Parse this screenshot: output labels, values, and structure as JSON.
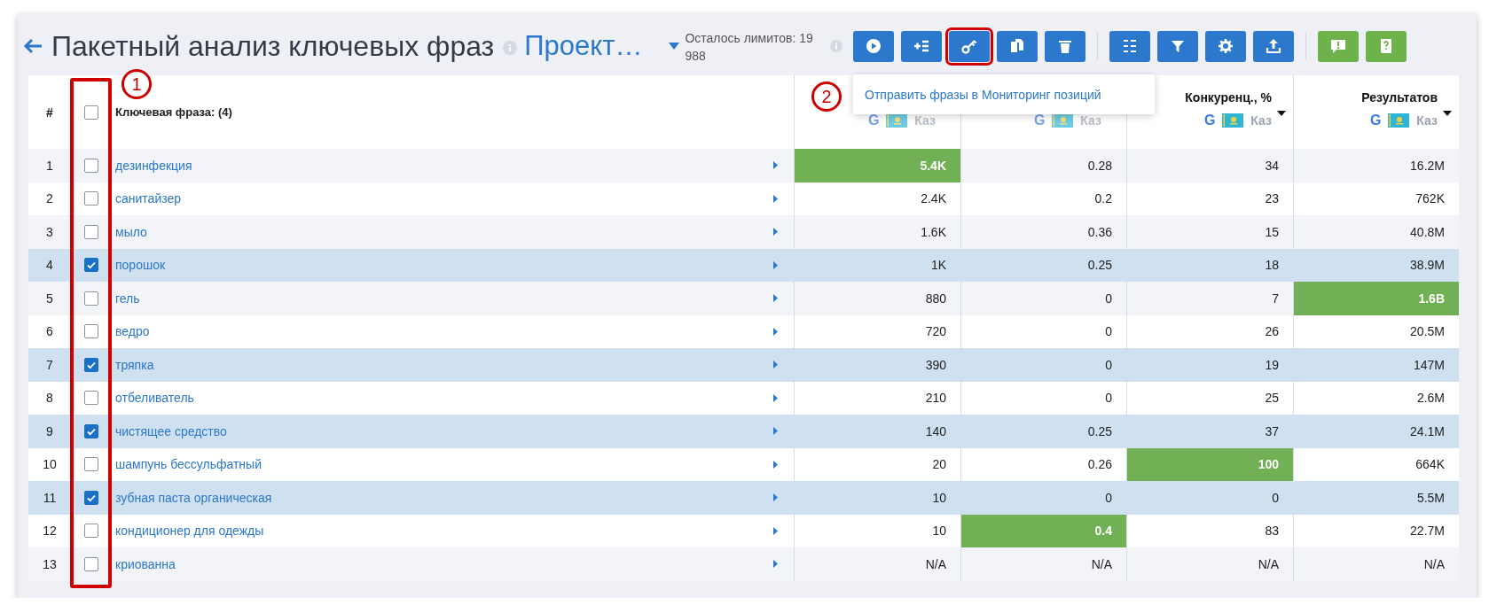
{
  "header": {
    "title": "Пакетный анализ ключевых фраз",
    "project": "Проект…",
    "limits": "Осталось лимитов: 19 988"
  },
  "toolbar": [
    {
      "kind": "play",
      "color": "#2b78cc",
      "outlined": false
    },
    {
      "kind": "add-list",
      "color": "#2b78cc",
      "outlined": false
    },
    {
      "kind": "key",
      "color": "#2b78cc",
      "outlined": true
    },
    {
      "kind": "copy",
      "color": "#2b78cc",
      "outlined": false
    },
    {
      "kind": "trash",
      "color": "#2b78cc",
      "outlined": false
    },
    {
      "kind": "columns",
      "color": "#2b78cc",
      "outlined": false
    },
    {
      "kind": "filter",
      "color": "#2b78cc",
      "outlined": false
    },
    {
      "kind": "gear",
      "color": "#2b78cc",
      "outlined": false
    },
    {
      "kind": "upload",
      "color": "#2b78cc",
      "outlined": false
    },
    {
      "kind": "alert",
      "color": "#6db24b",
      "outlined": false
    },
    {
      "kind": "help-book",
      "color": "#6db24b",
      "outlined": false
    }
  ],
  "popup": {
    "text": "Отправить фразы в Мониторинг позиций"
  },
  "markers": [
    "1",
    "2"
  ],
  "table": {
    "number_header": "#",
    "all_checked": false,
    "phrase_header": "Ключевая фраза: **(4)**",
    "columns": [
      {
        "engine": "G",
        "region": "Каз"
      },
      {
        "engine": "G",
        "region": "Каз"
      },
      {
        "title": "Конкуренц., %",
        "engine": "G",
        "region": "Каз",
        "sortable": true
      },
      {
        "title": "Результатов",
        "engine": "G",
        "region": "Каз",
        "sortable": true
      }
    ],
    "rows": [
      {
        "n": "1",
        "phrase": "дезинфекция",
        "checked": false,
        "cells": [
          {
            "v": "5.4K",
            "hl": true
          },
          {
            "v": "0.28",
            "hl": false
          },
          {
            "v": "34",
            "hl": false
          },
          {
            "v": "16.2M",
            "hl": false
          }
        ]
      },
      {
        "n": "2",
        "phrase": "санитайзер",
        "checked": false,
        "cells": [
          {
            "v": "2.4K",
            "hl": false
          },
          {
            "v": "0.2",
            "hl": false
          },
          {
            "v": "23",
            "hl": false
          },
          {
            "v": "762K",
            "hl": false
          }
        ]
      },
      {
        "n": "3",
        "phrase": "мыло",
        "checked": false,
        "cells": [
          {
            "v": "1.6K",
            "hl": false
          },
          {
            "v": "0.36",
            "hl": false
          },
          {
            "v": "15",
            "hl": false
          },
          {
            "v": "40.8M",
            "hl": false
          }
        ]
      },
      {
        "n": "4",
        "phrase": "порошок",
        "checked": true,
        "cells": [
          {
            "v": "1K",
            "hl": false
          },
          {
            "v": "0.25",
            "hl": false
          },
          {
            "v": "18",
            "hl": false
          },
          {
            "v": "38.9M",
            "hl": false
          }
        ]
      },
      {
        "n": "5",
        "phrase": "гель",
        "checked": false,
        "cells": [
          {
            "v": "880",
            "hl": false
          },
          {
            "v": "0",
            "hl": false
          },
          {
            "v": "7",
            "hl": false
          },
          {
            "v": "1.6B",
            "hl": true
          }
        ]
      },
      {
        "n": "6",
        "phrase": "ведро",
        "checked": false,
        "cells": [
          {
            "v": "720",
            "hl": false
          },
          {
            "v": "0",
            "hl": false
          },
          {
            "v": "26",
            "hl": false
          },
          {
            "v": "20.5M",
            "hl": false
          }
        ]
      },
      {
        "n": "7",
        "phrase": "тряпка",
        "checked": true,
        "cells": [
          {
            "v": "390",
            "hl": false
          },
          {
            "v": "0",
            "hl": false
          },
          {
            "v": "19",
            "hl": false
          },
          {
            "v": "147M",
            "hl": false
          }
        ]
      },
      {
        "n": "8",
        "phrase": "отбеливатель",
        "checked": false,
        "cells": [
          {
            "v": "210",
            "hl": false
          },
          {
            "v": "0",
            "hl": false
          },
          {
            "v": "25",
            "hl": false
          },
          {
            "v": "2.6M",
            "hl": false
          }
        ]
      },
      {
        "n": "9",
        "phrase": "чистящее средство",
        "checked": true,
        "cells": [
          {
            "v": "140",
            "hl": false
          },
          {
            "v": "0.25",
            "hl": false
          },
          {
            "v": "37",
            "hl": false
          },
          {
            "v": "24.1M",
            "hl": false
          }
        ]
      },
      {
        "n": "10",
        "phrase": "шампунь бессульфатный",
        "checked": false,
        "cells": [
          {
            "v": "20",
            "hl": false
          },
          {
            "v": "0.26",
            "hl": false
          },
          {
            "v": "100",
            "hl": true
          },
          {
            "v": "664K",
            "hl": false
          }
        ]
      },
      {
        "n": "11",
        "phrase": "зубная паста органическая",
        "checked": true,
        "cells": [
          {
            "v": "10",
            "hl": false
          },
          {
            "v": "0",
            "hl": false
          },
          {
            "v": "0",
            "hl": false
          },
          {
            "v": "5.5M",
            "hl": false
          }
        ]
      },
      {
        "n": "12",
        "phrase": "кондиционер для одежды",
        "checked": false,
        "cells": [
          {
            "v": "10",
            "hl": false
          },
          {
            "v": "0.4",
            "hl": true
          },
          {
            "v": "83",
            "hl": false
          },
          {
            "v": "22.7M",
            "hl": false
          }
        ]
      },
      {
        "n": "13",
        "phrase": "криованна",
        "checked": false,
        "cells": [
          {
            "v": "N/A",
            "hl": false
          },
          {
            "v": "N/A",
            "hl": false
          },
          {
            "v": "N/A",
            "hl": false
          },
          {
            "v": "N/A",
            "hl": false
          }
        ]
      }
    ]
  }
}
